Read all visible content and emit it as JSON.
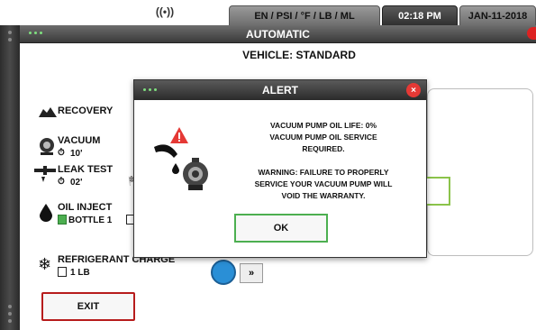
{
  "status_bar": {
    "wifi_icon": "broadcast-icon",
    "units": "EN / PSI / °F / LB / ML",
    "time": "02:18 PM",
    "date": "JAN-11-2018"
  },
  "main_window": {
    "title": "AUTOMATIC",
    "vehicle": "VEHICLE: STANDARD",
    "steps": {
      "recovery": {
        "label": "RECOVERY"
      },
      "vacuum": {
        "label": "VACUUM",
        "time": "10'"
      },
      "leak_test": {
        "label": "LEAK TEST",
        "time": "02'"
      },
      "oil_inject": {
        "label": "OIL INJECT",
        "bottle": "BOTTLE 1"
      },
      "refrigerant_charge": {
        "label": "REFRIGERANT CHARGE",
        "amount": "1 LB"
      }
    },
    "exit_label": "EXIT",
    "fast_forward_label": "»"
  },
  "alert": {
    "title": "ALERT",
    "close_label": "×",
    "line1": "VACUUM PUMP OIL LIFE: 0%",
    "line2": "VACUUM PUMP OIL SERVICE",
    "line3": "REQUIRED.",
    "line4": "WARNING: FAILURE TO PROPERLY",
    "line5": "SERVICE YOUR VACUUM PUMP WILL",
    "line6": "VOID THE WARRANTY.",
    "ok_label": "OK"
  },
  "colors": {
    "titlebar": "#3a3a3a",
    "warning_red": "#e53935",
    "ok_green": "#4caf50",
    "exit_red": "#b71c1c",
    "status_blue": "#2a8fd6"
  }
}
